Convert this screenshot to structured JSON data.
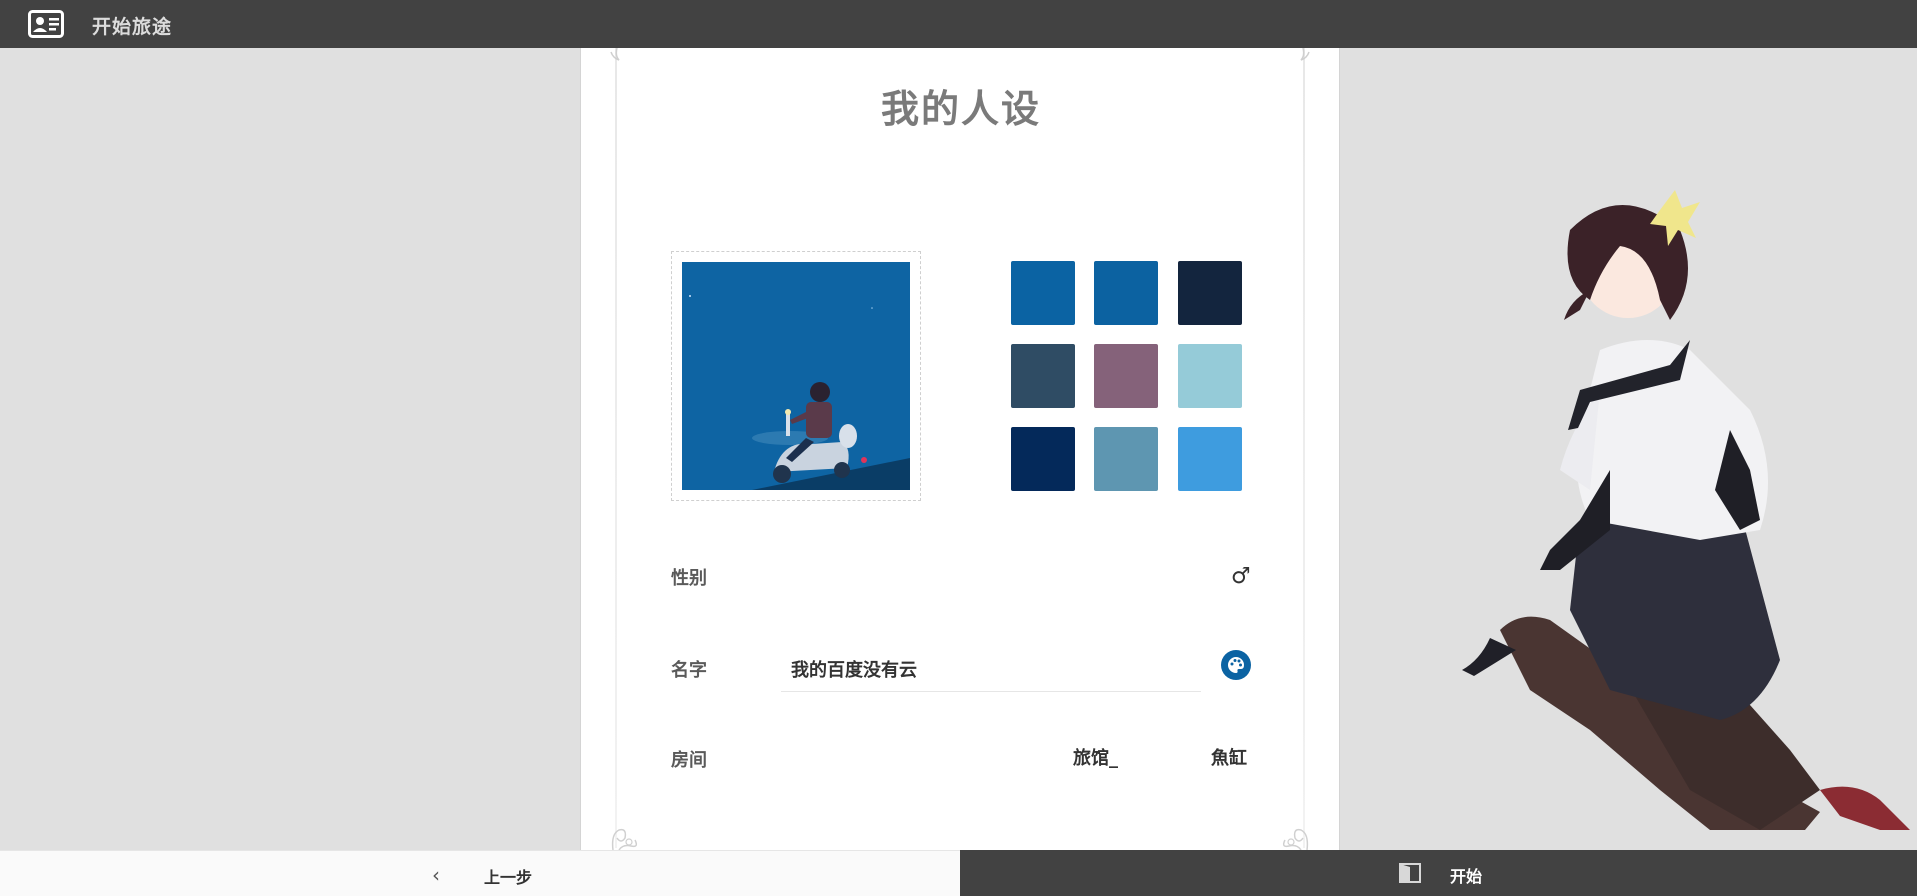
{
  "topbar": {
    "title": "开始旅途",
    "icon": "id-card-icon"
  },
  "panel": {
    "title": "我的人设"
  },
  "avatar": {
    "description_icon": "avatar-image"
  },
  "swatches": [
    {
      "color": "#0B63A3"
    },
    {
      "color": "#0C62A1"
    },
    {
      "color": "#13253E"
    },
    {
      "color": "#2F4C64"
    },
    {
      "color": "#85627A"
    },
    {
      "color": "#95CBD8"
    },
    {
      "color": "#04295A"
    },
    {
      "color": "#5E96B1"
    },
    {
      "color": "#3E9CDF"
    }
  ],
  "gender": {
    "label": "性别",
    "value": "♂"
  },
  "name": {
    "label": "名字",
    "value": "我的百度没有云",
    "palette_icon": "palette-icon"
  },
  "room": {
    "label": "房间",
    "options": [
      "旅馆_",
      "魚缸"
    ]
  },
  "bottom": {
    "prev_label": "上一步",
    "start_label": "开始",
    "prev_icon": "chevron-left-icon",
    "start_icon": "door-icon"
  },
  "colors": {
    "topbar": "#424242",
    "accent": "#0B63A3",
    "background": "#E0E0E0"
  }
}
